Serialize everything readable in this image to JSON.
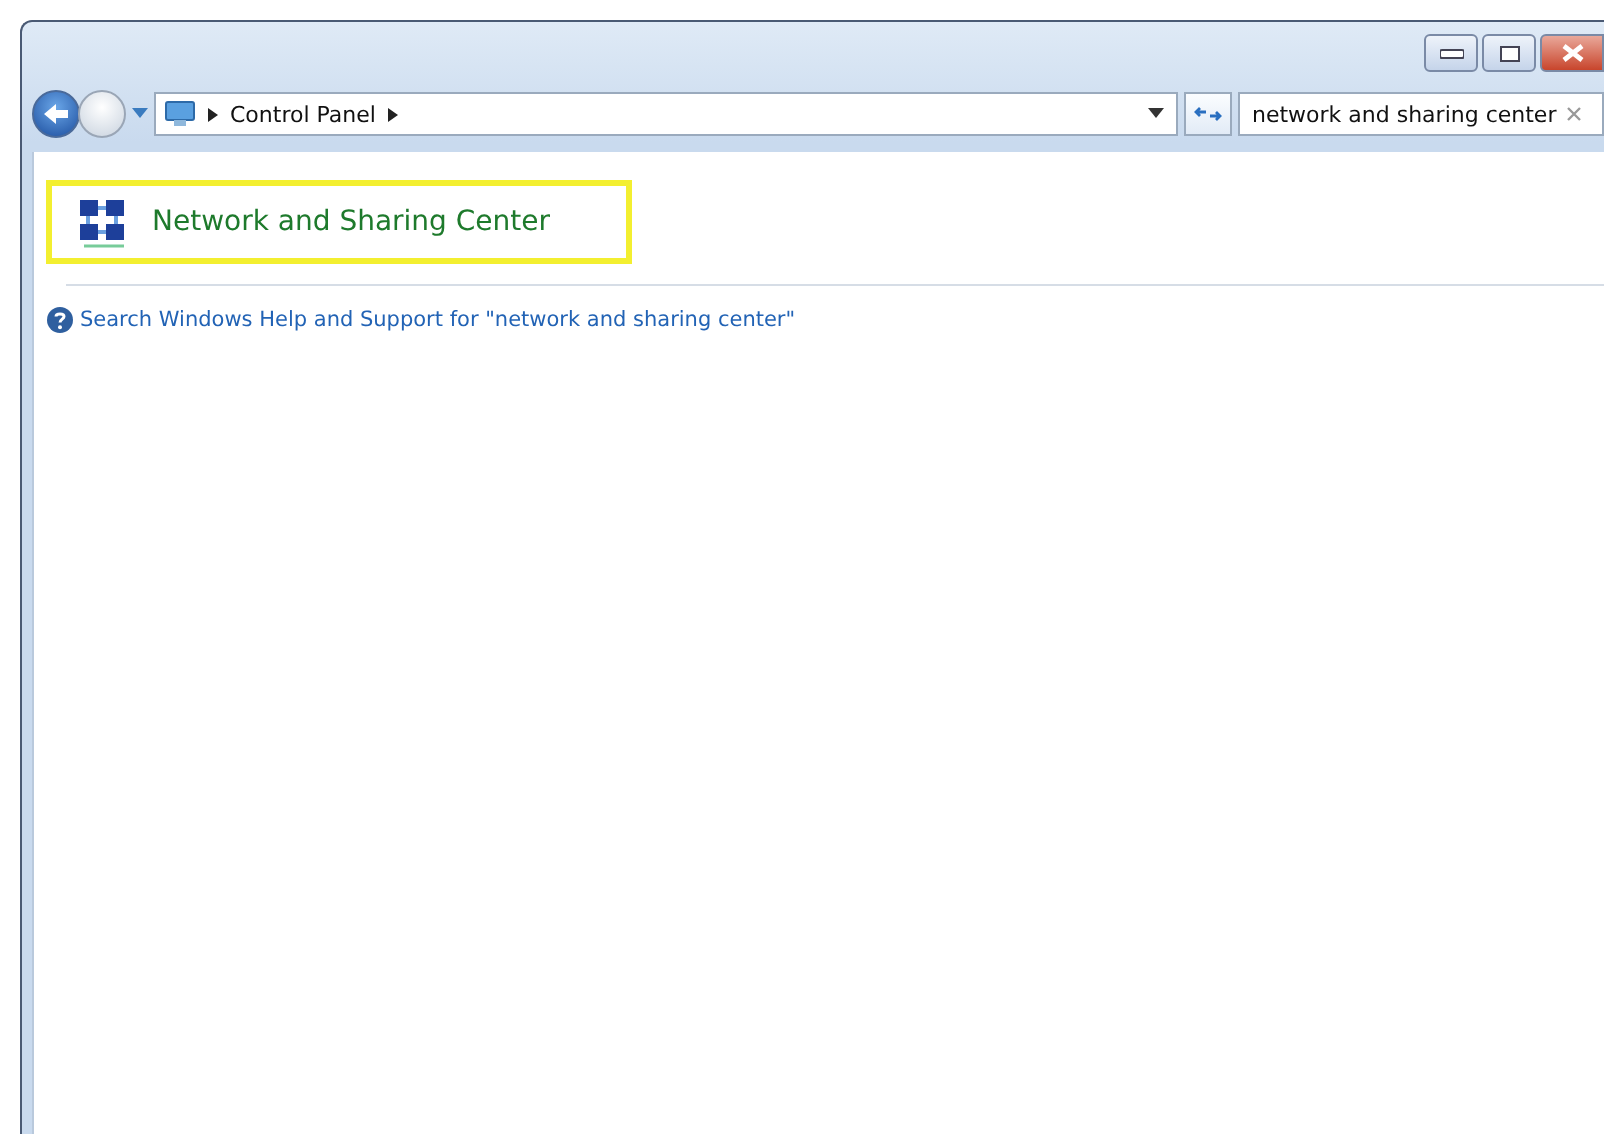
{
  "address_bar": {
    "breadcrumbs": [
      "Control Panel"
    ]
  },
  "search": {
    "value": "network and sharing center"
  },
  "results": [
    {
      "title": "Network and Sharing Center",
      "highlighted": true
    }
  ],
  "help_link": "Search Windows Help and Support for \"network and sharing center\""
}
